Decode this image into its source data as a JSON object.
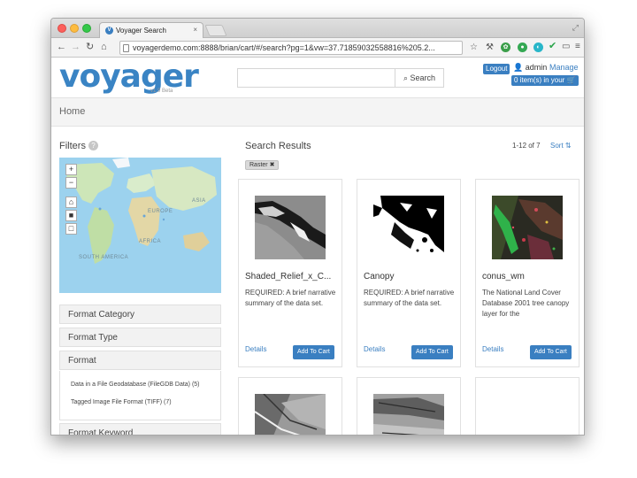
{
  "browser": {
    "tab_title": "Voyager Search",
    "url": "voyagerdemo.com:8888/brian/cart/#/search?pg=1&vw=37.71859032558816%205.2..."
  },
  "header": {
    "logo": "voyager",
    "logo_version": "v1.9 Beta",
    "search_label": "Search",
    "logout": "Logout",
    "user": "admin",
    "manage": "Manage",
    "cart": "0 item(s) in your"
  },
  "breadcrumb": "Home",
  "filters": {
    "title": "Filters",
    "map_labels": [
      "EUROPE",
      "AFRICA",
      "SOUTH AMERICA",
      "ASIA"
    ],
    "sections": [
      "Format Category",
      "Format Type",
      "Format",
      "Format Keyword"
    ],
    "format_items": [
      "Data in a File Geodatabase (FileGDB Data) (5)",
      "Tagged Image File Format (TIFF) (7)"
    ]
  },
  "results": {
    "title": "Search Results",
    "count": "1-12 of 7",
    "sort": "Sort",
    "tag": "Raster",
    "cards": [
      {
        "name": "Shaded_Relief_x_C...",
        "desc": "REQUIRED: A brief narrative summary of the data set.",
        "details": "Details",
        "add": "Add To Cart"
      },
      {
        "name": "Canopy",
        "desc": "REQUIRED: A brief narrative summary of the data set.",
        "details": "Details",
        "add": "Add To Cart"
      },
      {
        "name": "conus_wm",
        "desc": "The National Land Cover Database 2001 tree canopy layer for the",
        "details": "Details",
        "add": "Add To Cart"
      }
    ]
  },
  "colors": {
    "accent": "#3a7fc1",
    "logo": "#3a84c4"
  }
}
